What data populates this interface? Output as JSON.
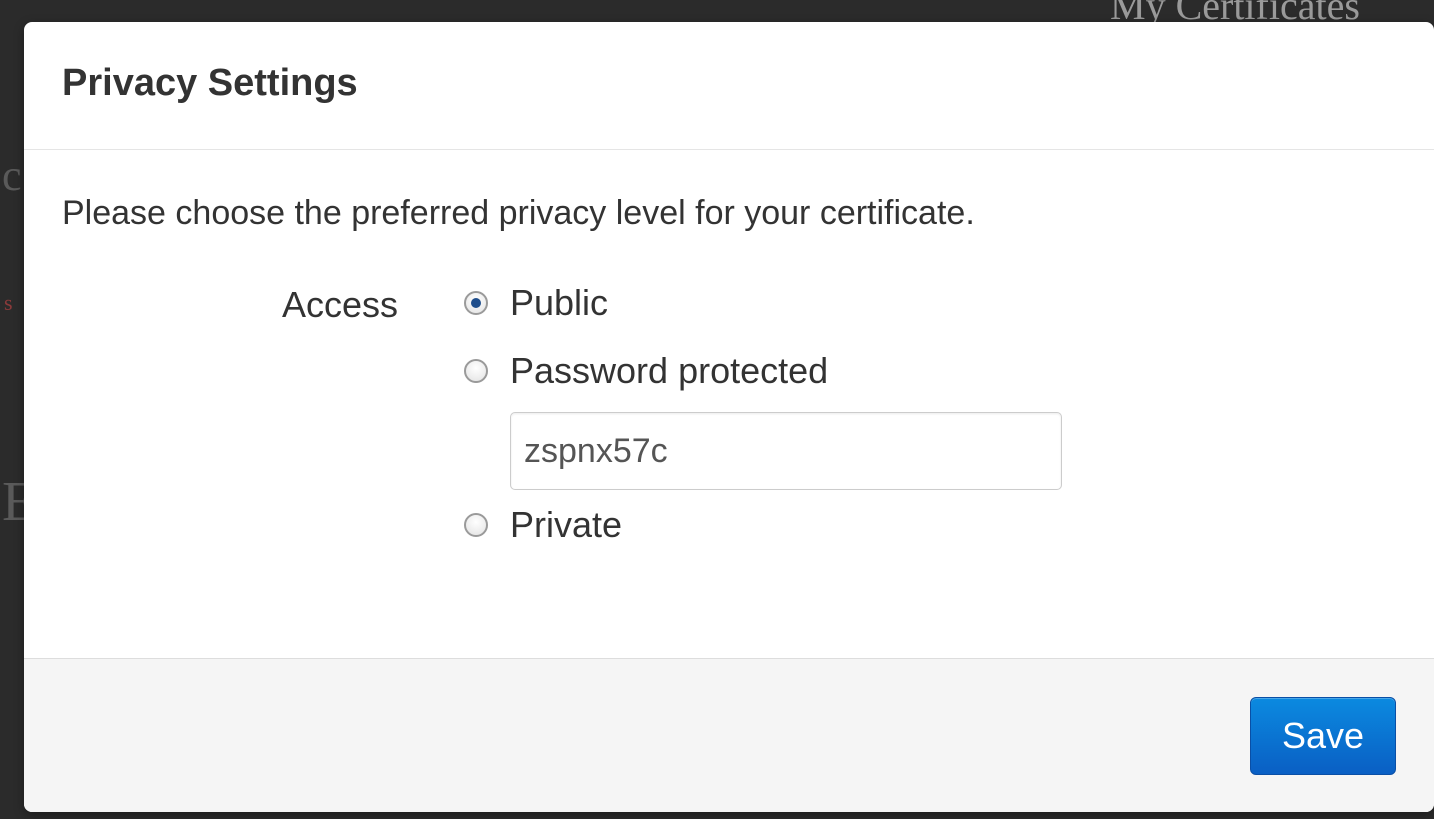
{
  "background": {
    "heading": "My Certificates"
  },
  "modal": {
    "title": "Privacy Settings",
    "intro": "Please choose the preferred privacy level for your certificate.",
    "access_label": "Access",
    "options": [
      {
        "label": "Public",
        "checked": true
      },
      {
        "label": "Password protected",
        "checked": false
      },
      {
        "label": "Private",
        "checked": false
      }
    ],
    "password_value": "zspnx57c",
    "save_label": "Save"
  },
  "colors": {
    "primary_button": "#0a6fd0",
    "footer_bg": "#f5f5f5",
    "text": "#333333"
  }
}
